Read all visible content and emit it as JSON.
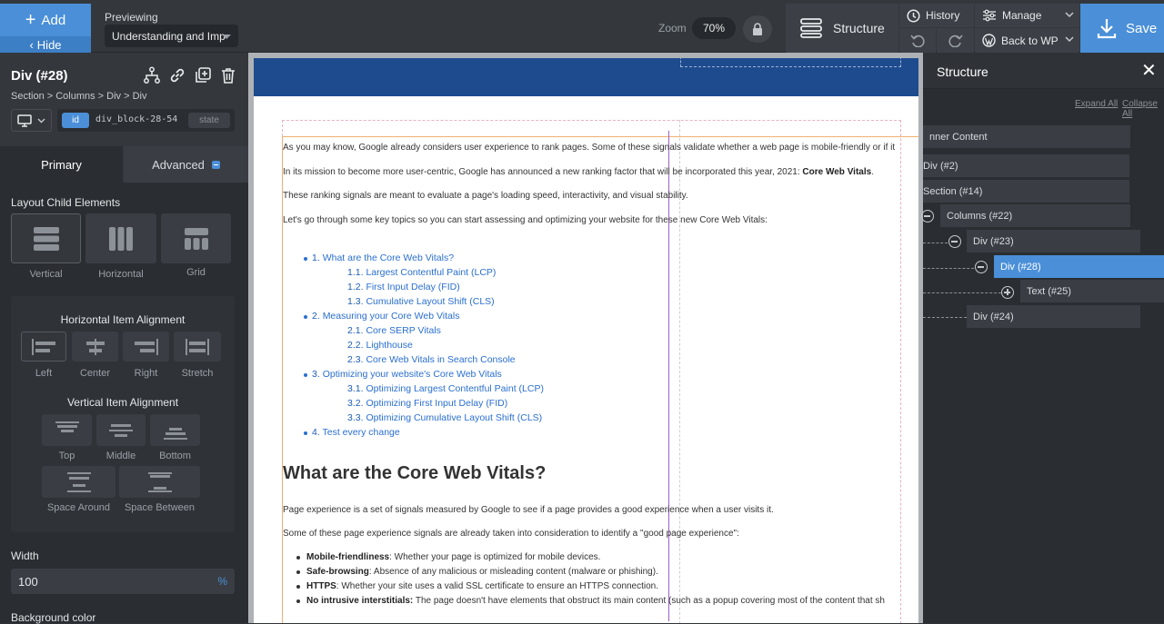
{
  "topbar": {
    "add_label": "Add",
    "hide_label": "Hide",
    "previewing_label": "Previewing",
    "preview_value": "Understanding and Imp",
    "zoom_label": "Zoom",
    "zoom_value": "70%",
    "structure_label": "Structure",
    "history_label": "History",
    "manage_label": "Manage",
    "back_label": "Back to WP",
    "save_label": "Save"
  },
  "left_panel": {
    "element_title": "Div (#28)",
    "breadcrumb": "Section > Columns > Div > Div",
    "id_tag": "id",
    "id_value": "div_block-28-54",
    "state_label": "state",
    "tabs": {
      "primary": "Primary",
      "advanced": "Advanced"
    },
    "layout_heading": "Layout Child Elements",
    "layout_options": [
      "Vertical",
      "Horizontal",
      "Grid"
    ],
    "h_align_heading": "Horizontal Item Alignment",
    "h_align_options": [
      "Left",
      "Center",
      "Right",
      "Stretch"
    ],
    "v_align_heading": "Vertical Item Alignment",
    "v_align_options": [
      "Top",
      "Middle",
      "Bottom",
      "Space Around",
      "Space Between"
    ],
    "width_label": "Width",
    "width_value": "100",
    "width_unit": "%",
    "bg_label": "Background color"
  },
  "canvas": {
    "p1": "As you may know, Google already considers user experience to rank pages. Some of these signals validate whether a web page is mobile-friendly or if it",
    "p2_a": "In its mission to become more user-centric, Google has announced a new ranking factor that will be incorporated this year, 2021: ",
    "p2_b": "Core Web Vitals",
    "p2_c": ".",
    "p3": "These ranking signals are meant to evaluate a page's loading speed, interactivity, and visual stability.",
    "p4": "Let's go through some key topics so you can start assessing and optimizing your website for these new Core Web Vitals:",
    "toc": [
      {
        "num": "1.",
        "text": "What are the Core Web Vitals?",
        "level": 1
      },
      {
        "num": "1.1.",
        "text": "Largest Contentful Paint (LCP)",
        "level": 2
      },
      {
        "num": "1.2.",
        "text": "First Input Delay (FID)",
        "level": 2
      },
      {
        "num": "1.3.",
        "text": "Cumulative Layout Shift (CLS)",
        "level": 2
      },
      {
        "num": "2.",
        "text": "Measuring your Core Web Vitals",
        "level": 1
      },
      {
        "num": "2.1.",
        "text": "Core SERP Vitals",
        "level": 2
      },
      {
        "num": "2.2.",
        "text": "Lighthouse",
        "level": 2
      },
      {
        "num": "2.3.",
        "text": "Core Web Vitals in Search Console",
        "level": 2
      },
      {
        "num": "3.",
        "text": "Optimizing your website's Core Web Vitals",
        "level": 1
      },
      {
        "num": "3.1.",
        "text": "Optimizing Largest Contentful Paint (LCP)",
        "level": 2
      },
      {
        "num": "3.2.",
        "text": "Optimizing First Input Delay (FID)",
        "level": 2
      },
      {
        "num": "3.3.",
        "text": "Optimizing Cumulative Layout Shift (CLS)",
        "level": 2
      },
      {
        "num": "4.",
        "text": "Test every change",
        "level": 1
      }
    ],
    "heading": "What are the Core Web Vitals?",
    "p5": "Page experience is a set of signals measured by Google to see if a page provides a good experience when a user visits it.",
    "p6": "Some of these page experience signals are already taken into consideration to identify a \"good page experience\":",
    "bullets": [
      {
        "bold": "Mobile-friendliness",
        "text": ": Whether your page is optimized for mobile devices."
      },
      {
        "bold": "Safe-browsing",
        "text": ": Absence of any malicious or misleading content (malware or phishing)."
      },
      {
        "bold": "HTTPS",
        "text": ": Whether your site uses a valid SSL certificate to ensure an HTTPS connection."
      },
      {
        "bold": "No intrusive interstitials:",
        "text": " The page doesn't have elements that obstruct its main content (such as a popup covering most of the content that sh"
      }
    ]
  },
  "structure": {
    "title": "Structure",
    "close_glyph": "✕",
    "expand_all": "Expand All",
    "collapse_all": "Collapse All",
    "items": [
      "nner Content",
      "Div (#2)",
      "Section (#14)",
      "Columns (#22)",
      "Div (#23)",
      "Div (#28)",
      "Text (#25)",
      "Div (#24)"
    ]
  },
  "colors": {
    "accent": "#4a8fd8",
    "header_blue": "#1e4b8e",
    "link_blue": "#2a6fd0"
  }
}
